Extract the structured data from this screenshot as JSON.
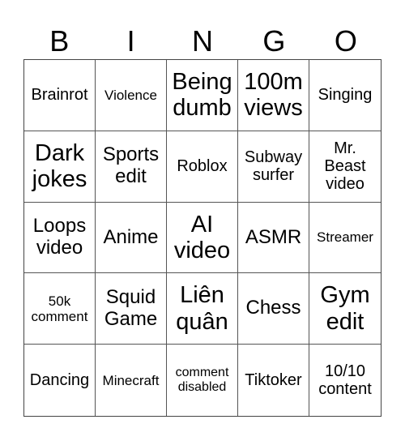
{
  "header": [
    "B",
    "I",
    "N",
    "G",
    "O"
  ],
  "cells": [
    {
      "text": "Brainrot",
      "size": "s2"
    },
    {
      "text": "Violence",
      "size": "s1"
    },
    {
      "text": "Being dumb",
      "size": "s4"
    },
    {
      "text": "100m views",
      "size": "s4"
    },
    {
      "text": "Singing",
      "size": "s2"
    },
    {
      "text": "Dark jokes",
      "size": "s4"
    },
    {
      "text": "Sports edit",
      "size": "s3"
    },
    {
      "text": "Roblox",
      "size": "s2"
    },
    {
      "text": "Subway surfer",
      "size": "s2"
    },
    {
      "text": "Mr. Beast video",
      "size": "s2"
    },
    {
      "text": "Loops video",
      "size": "s3"
    },
    {
      "text": "Anime",
      "size": "s3"
    },
    {
      "text": "AI video",
      "size": "s4"
    },
    {
      "text": "ASMR",
      "size": "s3"
    },
    {
      "text": "Streamer",
      "size": "s1"
    },
    {
      "text": "50k comment",
      "size": "s1"
    },
    {
      "text": "Squid Game",
      "size": "s3"
    },
    {
      "text": "Liên quân",
      "size": "s4"
    },
    {
      "text": "Chess",
      "size": "s3"
    },
    {
      "text": "Gym edit",
      "size": "s4"
    },
    {
      "text": "Dancing",
      "size": "s2"
    },
    {
      "text": "Minecraft",
      "size": "s1"
    },
    {
      "text": "comment disabled",
      "size": "s5"
    },
    {
      "text": "Tiktoker",
      "size": "s2"
    },
    {
      "text": "10/10 content",
      "size": "s2"
    }
  ]
}
